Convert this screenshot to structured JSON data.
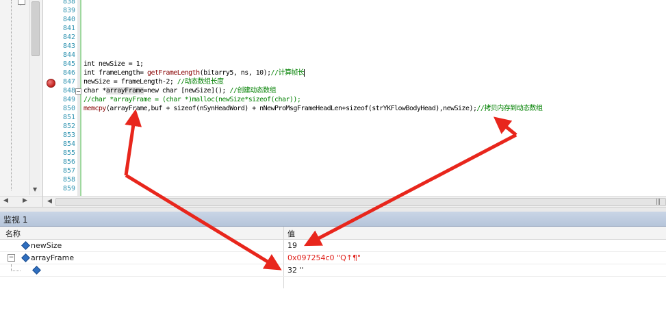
{
  "editor": {
    "line_numbers": [
      "838",
      "839",
      "840",
      "841",
      "842",
      "843",
      "844",
      "845",
      "846",
      "847",
      "848",
      "849",
      "850",
      "851",
      "852",
      "853",
      "854",
      "855",
      "856",
      "857",
      "858",
      "859"
    ],
    "code_lines": [
      {
        "plain": ""
      },
      {
        "plain": ""
      },
      {
        "plain": ""
      },
      {
        "plain": ""
      },
      {
        "plain": ""
      },
      {
        "plain": ""
      },
      {
        "plain": ""
      },
      {
        "plain": "int newSize = 1;"
      },
      {
        "pre": "int frameLength= ",
        "fn": "getFrameLength",
        "mid": "(bitarry5, ns, 10);",
        "cmt": "//计算帧长"
      },
      {
        "pre": "newSize = frameLength-2; ",
        "cmt": "//动态数组长度"
      },
      {
        "pre": "char *",
        "hl": "arrayFrame",
        "mid": "=new char [newSize](); ",
        "cmt": "//创建动态数组"
      },
      {
        "cmt_only": "//char *arrayFrame = (char *)malloc(newSize*sizeof(char));"
      },
      {
        "fn": "memcpy",
        "mid": "(arrayFrame,buf + sizeof(nSynHeadWord) + nNewProMsgFrameHeadLen+sizeof(strYKFlowBodyHead),newSize);",
        "cmt": "//拷贝内存到动态数组"
      },
      {
        "plain": ""
      },
      {
        "plain": ""
      },
      {
        "plain": ""
      },
      {
        "plain": ""
      },
      {
        "plain": ""
      },
      {
        "plain": ""
      },
      {
        "plain": ""
      },
      {
        "plain": ""
      },
      {
        "plain": ""
      }
    ]
  },
  "watch": {
    "title": "监视 1",
    "col_name": "名称",
    "col_value": "值",
    "rows": [
      {
        "name": "newSize",
        "value": "19"
      },
      {
        "name": "arrayFrame",
        "value": "0x097254c0 \"Q↑¶\""
      },
      {
        "name": "",
        "value": "32 ''"
      }
    ]
  },
  "colors": {
    "arrow": "#e8261c",
    "comment": "#008000",
    "line_number": "#2b91af",
    "changed_value": "#e0201a"
  }
}
